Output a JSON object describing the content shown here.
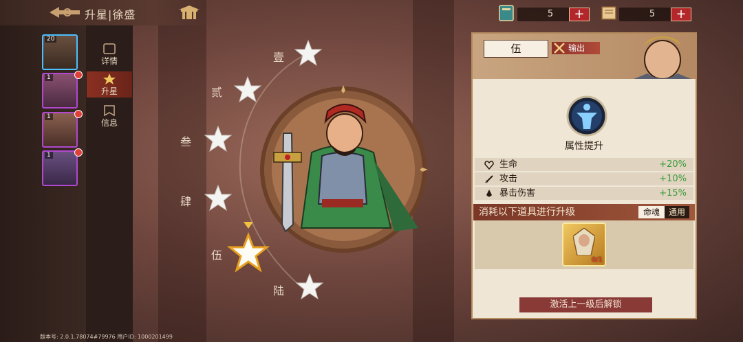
{
  "header": {
    "title": "升星|徐盛"
  },
  "resources": [
    {
      "icon": "book-icon",
      "count": "5"
    },
    {
      "icon": "scroll-icon",
      "count": "5"
    }
  ],
  "avatars": [
    {
      "level": "20",
      "selected": true,
      "alert": false
    },
    {
      "level": "1",
      "selected": false,
      "alert": true
    },
    {
      "level": "1",
      "selected": false,
      "alert": true
    },
    {
      "level": "1",
      "selected": false,
      "alert": true
    }
  ],
  "tabs": [
    {
      "label": "详情",
      "active": false
    },
    {
      "label": "升星",
      "active": true
    },
    {
      "label": "信息",
      "active": false
    }
  ],
  "stars": [
    {
      "label": "壹"
    },
    {
      "label": "贰"
    },
    {
      "label": "叁"
    },
    {
      "label": "肆"
    },
    {
      "label": "伍",
      "current": true
    },
    {
      "label": "陆"
    }
  ],
  "panel": {
    "rank": "伍",
    "role": "输出",
    "attr_title": "属性提升",
    "attributes": [
      {
        "name": "生命",
        "value": "+20%",
        "icon": "heart-icon"
      },
      {
        "name": "攻击",
        "value": "+10%",
        "icon": "sword-icon"
      },
      {
        "name": "暴击伤害",
        "value": "+15%",
        "icon": "crit-icon"
      }
    ],
    "consume_label": "消耗以下道具进行升级",
    "consume_tabs": [
      "命魂",
      "通用"
    ],
    "item": {
      "count": "0/1"
    },
    "unlock_button": "激活上一级后解锁"
  },
  "footer": {
    "version": "版本号: 2.0.1.78074#79976 用户ID: 1000201499"
  },
  "colors": {
    "accent_red": "#b3262a",
    "attr_green": "#3a9a3a",
    "panel_bg": "#f0e6d6"
  }
}
